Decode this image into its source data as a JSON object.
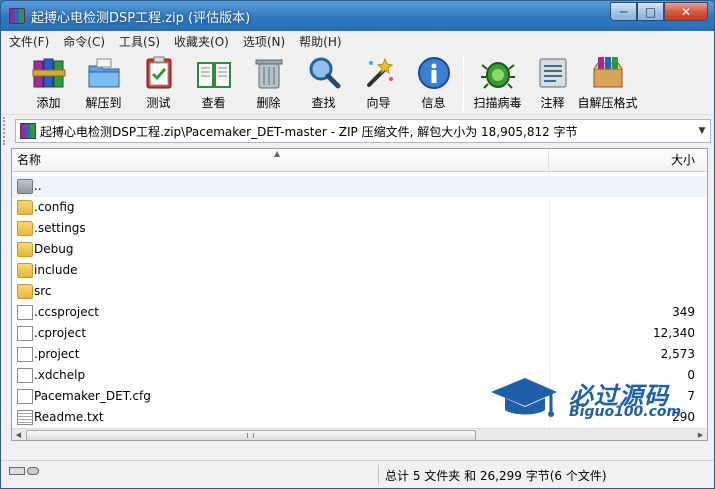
{
  "window": {
    "title": "起搏心电检测DSP工程.zip (评估版本)",
    "controls": {
      "minimize": "─",
      "maximize": "□",
      "close": "✕"
    }
  },
  "menu": [
    "文件(F)",
    "命令(C)",
    "工具(S)",
    "收藏夹(O)",
    "选项(N)",
    "帮助(H)"
  ],
  "toolbar": [
    {
      "id": "add",
      "label": "添加",
      "icon": "books-icon"
    },
    {
      "id": "extract",
      "label": "解压到",
      "icon": "folder-extract-icon"
    },
    {
      "id": "test",
      "label": "测试",
      "icon": "clipboard-check-icon"
    },
    {
      "id": "view",
      "label": "查看",
      "icon": "book-icon"
    },
    {
      "id": "delete",
      "label": "删除",
      "icon": "trash-icon"
    },
    {
      "id": "find",
      "label": "查找",
      "icon": "magnifier-icon"
    },
    {
      "id": "wizard",
      "label": "向导",
      "icon": "magic-wand-icon"
    },
    {
      "id": "info",
      "label": "信息",
      "icon": "info-icon"
    },
    {
      "id": "scan",
      "label": "扫描病毒",
      "icon": "bug-icon"
    },
    {
      "id": "comment",
      "label": "注释",
      "icon": "note-icon"
    },
    {
      "id": "sfx",
      "label": "自解压格式",
      "icon": "box-icon"
    }
  ],
  "address": {
    "path": "起搏心电检测DSP工程.zip\\Pacemaker_DET-master - ZIP 压缩文件, 解包大小为 18,905,812 字节"
  },
  "columns": {
    "name": "名称",
    "size": "大小"
  },
  "files": [
    {
      "name": "..",
      "size": "",
      "type": "up"
    },
    {
      "name": ".config",
      "size": "",
      "type": "folder"
    },
    {
      "name": ".settings",
      "size": "",
      "type": "folder"
    },
    {
      "name": "Debug",
      "size": "",
      "type": "folder"
    },
    {
      "name": "include",
      "size": "",
      "type": "folder"
    },
    {
      "name": "src",
      "size": "",
      "type": "folder"
    },
    {
      "name": ".ccsproject",
      "size": "349",
      "type": "file"
    },
    {
      "name": ".cproject",
      "size": "12,340",
      "type": "file"
    },
    {
      "name": ".project",
      "size": "2,573",
      "type": "file"
    },
    {
      "name": ".xdchelp",
      "size": "0",
      "type": "file"
    },
    {
      "name": "Pacemaker_DET.cfg",
      "size": "7",
      "type": "file"
    },
    {
      "name": "Readme.txt",
      "size": "290",
      "type": "text"
    }
  ],
  "status": {
    "summary": "总计 5 文件夹 和 26,299 字节(6 个文件)"
  },
  "watermark": {
    "title": "必过源码",
    "subtitle": "Biguo100.com"
  },
  "colors": {
    "titlebar": "#2f78bf",
    "watermark": "#1f5fa8",
    "folder": "#e7b73c"
  }
}
